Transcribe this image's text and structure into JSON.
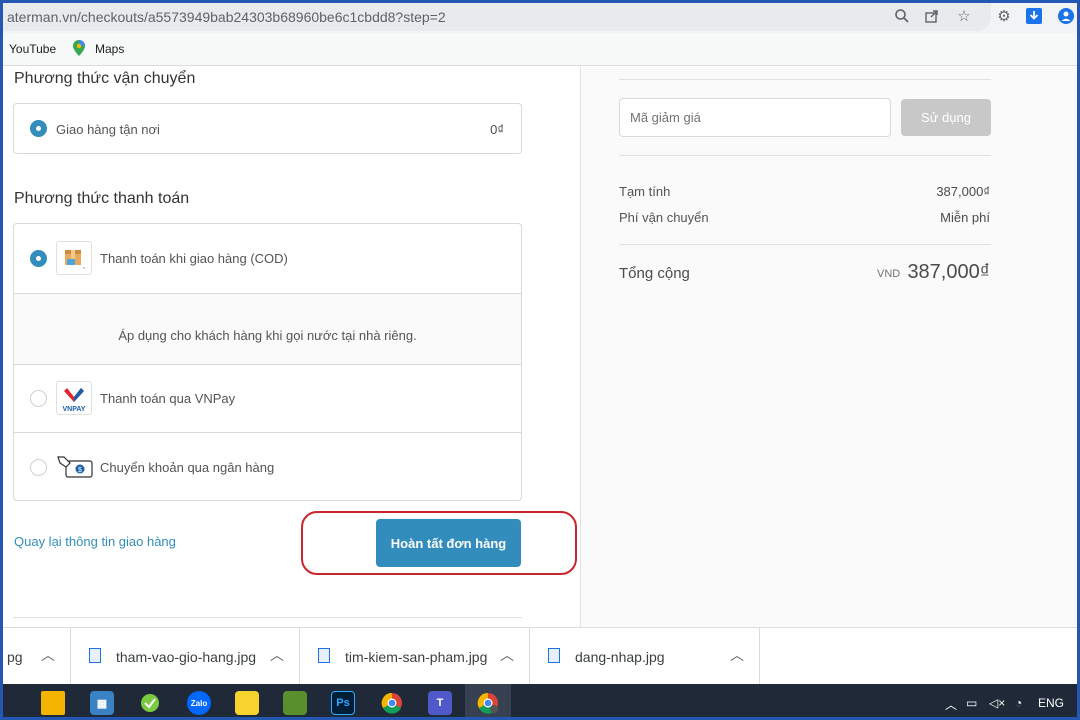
{
  "browser": {
    "url": "aterman.vn/checkouts/a5573949bab24303b68960be6c1cbdd8?step=2",
    "bookmarks": [
      {
        "label": "YouTube"
      },
      {
        "label": "Maps"
      }
    ]
  },
  "shipping": {
    "title": "Phương thức vận chuyển",
    "option_label": "Giao hàng tận nơi",
    "option_price": "0₫"
  },
  "payment": {
    "title": "Phương thức thanh toán",
    "methods": [
      {
        "label": "Thanh toán khi giao hàng (COD)",
        "selected": true,
        "icon": "cod-box-icon"
      },
      {
        "label": "Thanh toán qua VNPay",
        "selected": false,
        "icon": "vnpay-logo-icon"
      },
      {
        "label": "Chuyển khoản qua ngân hàng",
        "selected": false,
        "icon": "bank-transfer-icon"
      }
    ],
    "cod_note": "Áp dụng cho khách hàng khi gọi nước tại nhà riêng.",
    "vnpay_logo_text": "VNPAY"
  },
  "actions": {
    "back_link": "Quay lại thông tin giao hàng",
    "complete_button": "Hoàn tất đơn hàng"
  },
  "summary": {
    "discount_placeholder": "Mã giảm giá",
    "apply_button": "Sử dụng",
    "subtotal_label": "Tạm tính",
    "subtotal_value": "387,000₫",
    "shipping_label": "Phí vận chuyển",
    "shipping_value": "Miễn phí",
    "total_label": "Tổng cộng",
    "currency": "VND",
    "total_value": "387,000₫"
  },
  "downloads": [
    {
      "name": "pg"
    },
    {
      "name": "tham-vao-gio-hang.jpg"
    },
    {
      "name": "tim-kiem-san-pham.jpg"
    },
    {
      "name": "dang-nhap.jpg"
    }
  ],
  "taskbar": {
    "language": "ENG",
    "apps": [
      "file-explorer-icon",
      "store-icon",
      "app-icon",
      "zalo-icon",
      "sticky-notes-icon",
      "photo-editor-icon",
      "photoshop-icon",
      "chrome-icon",
      "teams-icon",
      "chrome-profile-icon"
    ],
    "zalo_label": "Zalo",
    "ps_label": "Ps"
  },
  "colors": {
    "accent": "#338dbc",
    "highlight": "#c9252c"
  }
}
